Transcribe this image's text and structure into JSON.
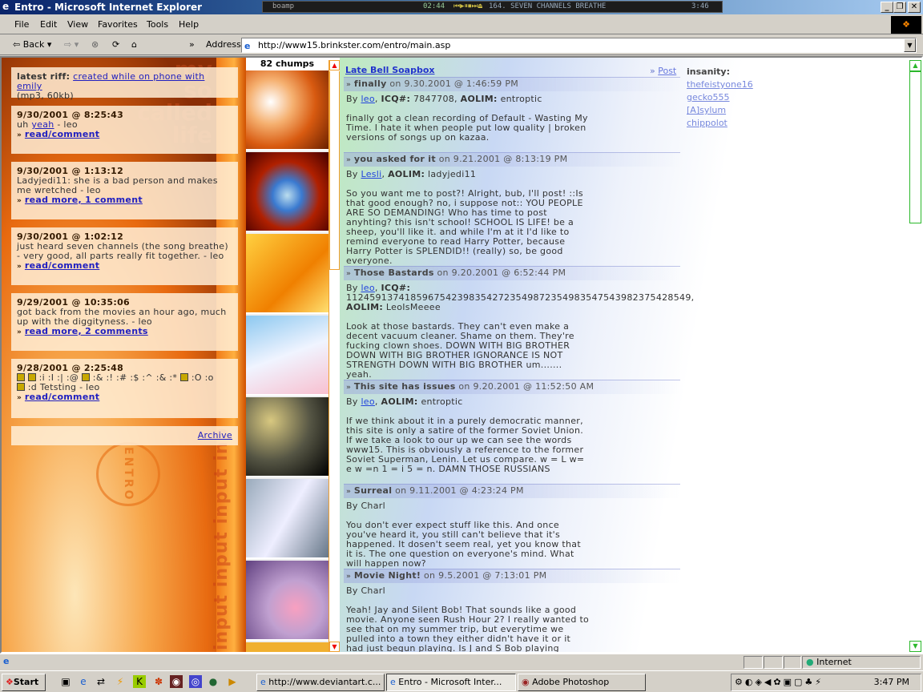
{
  "window": {
    "title": "Entro - Microsoft Internet Explorer"
  },
  "player": {
    "name": "boamp",
    "time": "02:44",
    "track": "164. SEVEN CHANNELS  BREATHE",
    "track_time": "3:46"
  },
  "menu": [
    "File",
    "Edit",
    "View",
    "Favorites",
    "Tools",
    "Help"
  ],
  "toolbar": {
    "back": "Back",
    "chevron": "»",
    "address_label": "Address",
    "url": "http://www15.brinkster.com/entro/main.asp"
  },
  "left": {
    "watermark": [
      "my",
      "so",
      "called",
      "life"
    ],
    "vertical_text": "input input input inp",
    "emblem": "ENTRO",
    "riff": {
      "label": "latest riff:",
      "link": "created while on phone with emily",
      "meta": "(mp3, 60kb)"
    },
    "posts": [
      {
        "ts": "9/30/2001 @ 8:25:43",
        "pre": "uh ",
        "link": "yeah",
        "post": " - leo",
        "action": "read/comment"
      },
      {
        "ts": "9/30/2001 @ 1:13:12",
        "text": "Ladyjedi11: she is a bad person and makes me wretched - leo",
        "action": "read more, 1 comment"
      },
      {
        "ts": "9/30/2001 @ 1:02:12",
        "text": "just heard seven channels (the song breathe) - very good, all parts really fit together. - leo",
        "action": "read/comment"
      },
      {
        "ts": "9/29/2001 @ 10:35:06",
        "text": "got back from the movies an hour ago, much up with the diggityness. - leo",
        "action": "read more, 2 comments"
      },
      {
        "ts": "9/28/2001 @ 2:25:48",
        "text1": " :i :I :| :@ ",
        "text2": " :& :! :# :$ :^ :& :* ",
        "text3": " :O :o",
        "text4": " :d Tetsting - leo",
        "action": "read/comment"
      }
    ],
    "archive": "Archive"
  },
  "strip": {
    "count_label": "82 chumps"
  },
  "main": {
    "title": "Late Bell Soapbox",
    "post_link": "Post",
    "insanity_label": "insanity:",
    "users": [
      "thefeistyone16",
      "gecko555",
      "[A]sylum",
      "chippolot"
    ],
    "posts": [
      {
        "title": "finally",
        "date": "on 9.30.2001 @ 1:46:59 PM",
        "author": "leo",
        "icq": "7847708",
        "aolim": "entroptic",
        "body": "finally got a clean recording of Default - Wasting My Time. I hate it when people put low quality | broken versions of songs up on kazaa."
      },
      {
        "title": "you asked for it",
        "date": "on 9.21.2001 @ 8:13:19 PM",
        "author": "Lesli",
        "aolim": "ladyjedi11",
        "body": "So you want me to post?! Alright, bub, I'll post! ::Is that good enough? no, i suppose not:: YOU PEOPLE ARE SO DEMANDING! Who has time to post anyhting? this isn't school! SCHOOL IS LIFE! be a sheep, you'll like it. and while I'm at it I'd like to remind everyone to read Harry Potter, because Harry Potter is SPLENDID!! (really) so, be good everyone."
      },
      {
        "title": "Those Bastards",
        "date": "on 9.20.2001 @ 6:52:44 PM",
        "author": "leo",
        "icq": "11245913741859675423983542723549872354983547543982375428549",
        "aolim": "LeoIsMeeee",
        "body": "Look at those bastards. They can't even make a decent vacuum cleaner. Shame on them. They're fucking clown shoes. DOWN WITH BIG BROTHER DOWN WITH BIG BROTHER IGNORANCE IS NOT STRENGTH DOWN WITH BIG BROTHER um....... yeah."
      },
      {
        "title": "This site has issues",
        "date": "on 9.20.2001 @ 11:52:50 AM",
        "author": "leo",
        "aolim": "entroptic",
        "body": "If we think about it in a purely democratic manner, this site is only a satire of the former Soviet Union. If we take a look to our up we can see the words www15. This is obviously a reference to the former Soviet Superman, Lenin. Let us compare. w = L w= e w =n 1 = i 5 = n. DAMN THOSE RUSSIANS"
      },
      {
        "title": "Surreal",
        "date": "on 9.11.2001 @ 4:23:24 PM",
        "author_plain": "Charl",
        "body": "You don't ever expect stuff like this. And once you've heard it, you still can't believe that it's happened. It dosen't seem real, yet you know that it is. The one question on everyone's mind. What will happen now?"
      },
      {
        "title": "Movie Night!",
        "date": "on 9.5.2001 @ 7:13:01 PM",
        "author_plain": "Charl",
        "body": "Yeah! Jay and Silent Bob! That sounds like a good movie. Anyone seen Rush Hour 2? I really wanted to see that on my summer trip, but everytime we pulled into a town they either didn't have it or it had just begun playing. Is J and S Bob playing locally?"
      }
    ],
    "labels": {
      "by": "By ",
      "icq": "ICQ#:",
      "aolim": "AOLIM:",
      "arrow": "»"
    }
  },
  "status": {
    "zone": "Internet"
  },
  "taskbar": {
    "start": "Start",
    "tasks": [
      "http://www.deviantart.c...",
      "Entro - Microsoft Inter...",
      "Adobe Photoshop"
    ],
    "clock": "3:47 PM"
  }
}
